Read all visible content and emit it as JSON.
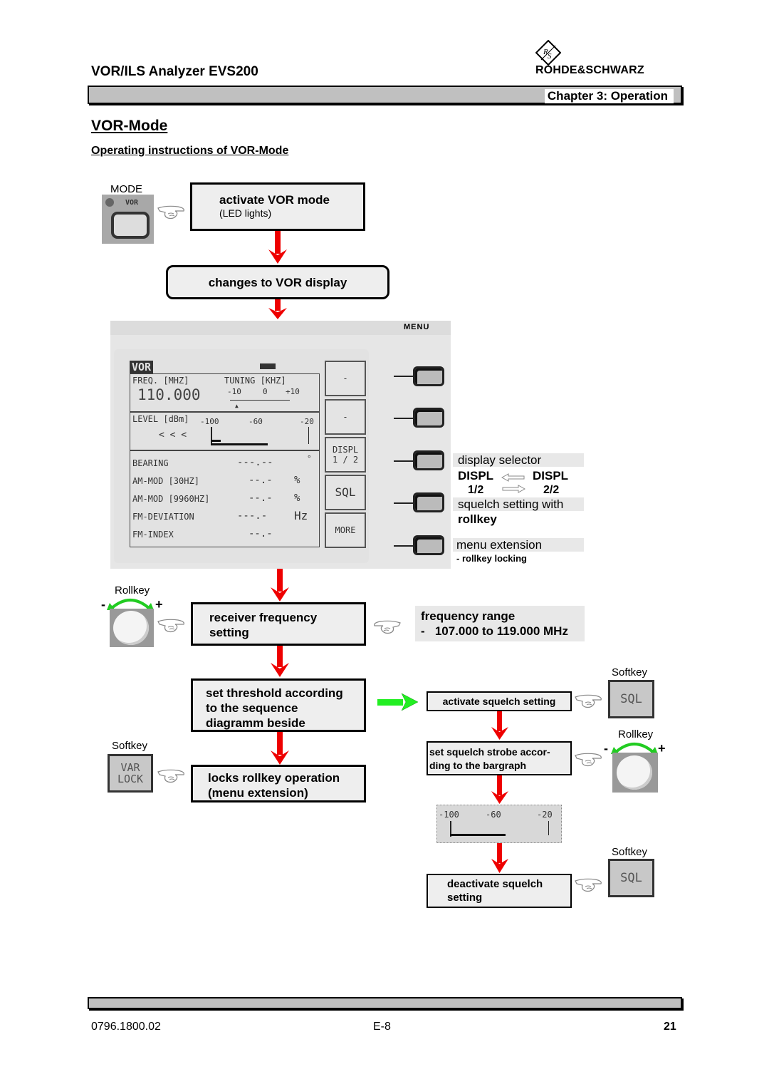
{
  "header": {
    "doc_title": "VOR/ILS Analyzer EVS200",
    "brand": "ROHDE&SCHWARZ",
    "brand_mark": "R&S",
    "chapter": "Chapter 3: Operation"
  },
  "headings": {
    "section": "VOR-Mode",
    "subsection": "Operating instructions of VOR-Mode"
  },
  "left_flow": {
    "mode_label": "MODE",
    "mode_key_label": "VOR",
    "step1_title": "activate VOR mode",
    "step1_note": "(LED lights)",
    "step2": "changes to VOR display",
    "rollkey_label": "Rollkey",
    "rollkey_minus": "-",
    "rollkey_plus": "+",
    "step3_line1": "receiver frequency",
    "step3_line2": "setting",
    "step4_line1": "set threshold according",
    "step4_line2": "to the sequence",
    "step4_line3": "diagramm beside",
    "softkey_label": "Softkey",
    "varlock_line1": "VAR",
    "varlock_line2": "LOCK",
    "step5_line1": "locks rollkey operation",
    "step5_line2": "(menu extension)"
  },
  "lcd": {
    "mode": "VOR",
    "freq_label": "FREQ. [MHZ]",
    "tuning_label": "TUNING [KHZ]",
    "freq_value": "110.000",
    "tuning_ticks": [
      "-10",
      "0",
      "+10"
    ],
    "level_label": "LEVEL [dBm]",
    "level_indicator": "< < <",
    "level_ticks": [
      "-100",
      "-60",
      "-20"
    ],
    "rows": [
      {
        "label": "BEARING",
        "value": "---.--",
        "unit": "°"
      },
      {
        "label": "AM-MOD [30HZ]",
        "value": "--.-",
        "unit": "%"
      },
      {
        "label": "AM-MOD [9960HZ]",
        "value": "--.-",
        "unit": "%"
      },
      {
        "label": "FM-DEVIATION",
        "value": "---.-",
        "unit": "Hz"
      },
      {
        "label": "FM-INDEX",
        "value": "--.-",
        "unit": ""
      }
    ],
    "softkeys": [
      "-",
      "-",
      "DISPL\n1 / 2",
      "SQL",
      "MORE"
    ],
    "menu_label": "MENU"
  },
  "annotations": {
    "display_selector": "display selector",
    "displ_left": "DISPL",
    "displ_left_page": "1/2",
    "displ_right": "DISPL",
    "displ_right_page": "2/2",
    "squelch_with": "squelch setting with",
    "rollkey": "rollkey",
    "menu_extension": "menu extension",
    "rollkey_locking": "- rollkey locking"
  },
  "right_flow": {
    "freq_range_title": "frequency range",
    "freq_range_value": "-   107.000 to 119.000 MHz",
    "softkey_label": "Softkey",
    "sql_label": "SQL",
    "step_a": "activate squelch setting",
    "rollkey_label": "Rollkey",
    "rollkey_minus": "-",
    "rollkey_plus": "+",
    "step_b_line1": "set squelch strobe accor-",
    "step_b_line2": "ding  to the bargraph",
    "bargraph_ticks": [
      "-100",
      "-60",
      "-20"
    ],
    "step_c_line1": "deactivate squelch",
    "step_c_line2": "setting"
  },
  "footer": {
    "doc_number": "0796.1800.02",
    "page_code": "E-8",
    "page_number": "21"
  },
  "colors": {
    "flow_arrow": "#ee0000",
    "branch_arrow": "#22ee22",
    "rollkey_arrow": "#22cc22",
    "bar_gray": "#c0c0c0"
  }
}
